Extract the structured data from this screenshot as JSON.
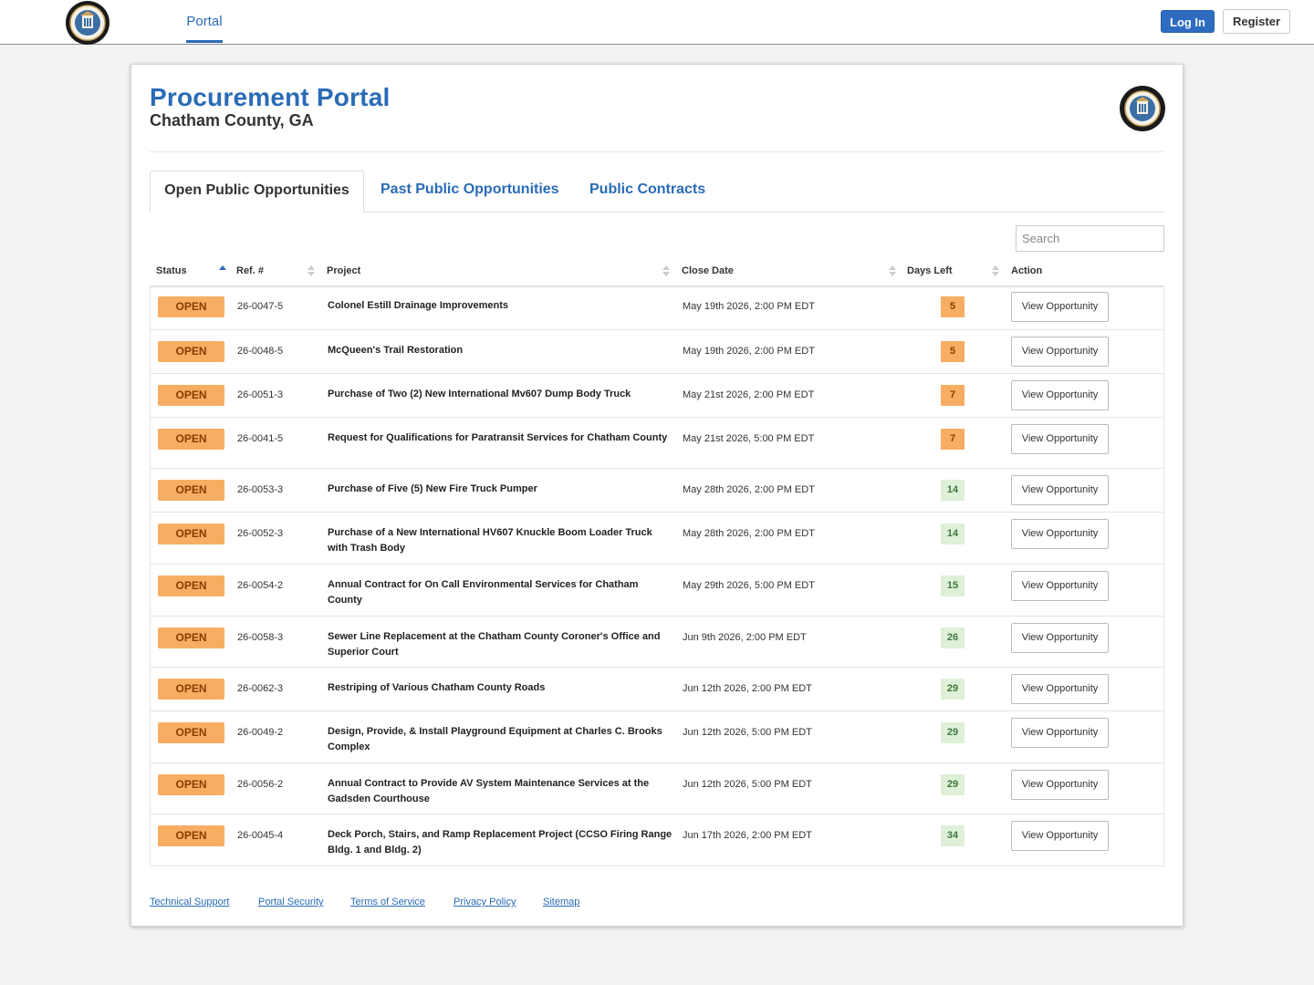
{
  "nav": {
    "tab": "Portal",
    "login": "Log In",
    "register": "Register"
  },
  "header": {
    "title": "Procurement Portal",
    "subtitle": "Chatham County, GA"
  },
  "tabs": [
    {
      "label": "Open Public Opportunities",
      "active": true
    },
    {
      "label": "Past Public Opportunities",
      "active": false
    },
    {
      "label": "Public Contracts",
      "active": false
    }
  ],
  "search": {
    "placeholder": "Search",
    "value": ""
  },
  "table": {
    "columns": [
      "Status",
      "Ref. #",
      "Project",
      "Close Date",
      "Days Left",
      "Action"
    ],
    "sorted_by": "Status",
    "rows": [
      {
        "status": "OPEN",
        "ref": "26-0047-5",
        "project": "Colonel Estill Drainage Improvements",
        "close": "May 19th 2026, 2:00 PM EDT",
        "days": "5",
        "days_state": "warn",
        "action": "View Opportunity"
      },
      {
        "status": "OPEN",
        "ref": "26-0048-5",
        "project": "McQueen's Trail Restoration",
        "close": "May 19th 2026, 2:00 PM EDT",
        "days": "5",
        "days_state": "warn",
        "action": "View Opportunity"
      },
      {
        "status": "OPEN",
        "ref": "26-0051-3",
        "project": "Purchase of Two (2) New International Mv607 Dump Body Truck",
        "close": "May 21st 2026, 2:00 PM EDT",
        "days": "7",
        "days_state": "warn",
        "action": "View Opportunity"
      },
      {
        "status": "OPEN",
        "ref": "26-0041-5",
        "project": "Request for Qualifications for Paratransit Services for Chatham County",
        "close": "May 21st 2026, 5:00 PM EDT",
        "days": "7",
        "days_state": "warn",
        "action": "View Opportunity"
      },
      {
        "status": "OPEN",
        "ref": "26-0053-3",
        "project": "Purchase of Five (5) New Fire Truck Pumper",
        "close": "May 28th 2026, 2:00 PM EDT",
        "days": "14",
        "days_state": "ok",
        "action": "View Opportunity"
      },
      {
        "status": "OPEN",
        "ref": "26-0052-3",
        "project": "Purchase of a New International HV607 Knuckle Boom Loader Truck with Trash Body",
        "close": "May 28th 2026, 2:00 PM EDT",
        "days": "14",
        "days_state": "ok",
        "action": "View Opportunity"
      },
      {
        "status": "OPEN",
        "ref": "26-0054-2",
        "project": "Annual Contract for On Call Environmental Services for Chatham County",
        "close": "May 29th 2026, 5:00 PM EDT",
        "days": "15",
        "days_state": "ok",
        "action": "View Opportunity"
      },
      {
        "status": "OPEN",
        "ref": "26-0058-3",
        "project": "Sewer Line Replacement at the Chatham County Coroner's Office and Superior Court",
        "close": "Jun 9th 2026, 2:00 PM EDT",
        "days": "26",
        "days_state": "ok",
        "action": "View Opportunity"
      },
      {
        "status": "OPEN",
        "ref": "26-0062-3",
        "project": "Restriping of Various Chatham County Roads",
        "close": "Jun 12th 2026, 2:00 PM EDT",
        "days": "29",
        "days_state": "ok",
        "action": "View Opportunity"
      },
      {
        "status": "OPEN",
        "ref": "26-0049-2",
        "project": "Design, Provide, & Install Playground Equipment at Charles C. Brooks Complex",
        "close": "Jun 12th 2026, 5:00 PM EDT",
        "days": "29",
        "days_state": "ok",
        "action": "View Opportunity"
      },
      {
        "status": "OPEN",
        "ref": "26-0056-2",
        "project": "Annual Contract to Provide AV System Maintenance Services at the Gadsden Courthouse",
        "close": "Jun 12th 2026, 5:00 PM EDT",
        "days": "29",
        "days_state": "ok",
        "action": "View Opportunity"
      },
      {
        "status": "OPEN",
        "ref": "26-0045-4",
        "project": "Deck Porch, Stairs, and Ramp Replacement Project (CCSO Firing Range Bldg. 1 and Bldg. 2)",
        "close": "Jun 17th 2026, 2:00 PM EDT",
        "days": "34",
        "days_state": "ok",
        "action": "View Opportunity"
      }
    ]
  },
  "footer": {
    "links": [
      "Technical Support",
      "Portal Security",
      "Terms of Service",
      "Privacy Policy",
      "Sitemap"
    ]
  },
  "colors": {
    "accent": "#2a6bb6",
    "open_badge": "#f7ae63",
    "days_warn": "#f7ae63",
    "days_ok": "#dff0d8"
  },
  "icons": {
    "logo": "county-seal-icon",
    "sort": "sort-arrows-icon"
  }
}
